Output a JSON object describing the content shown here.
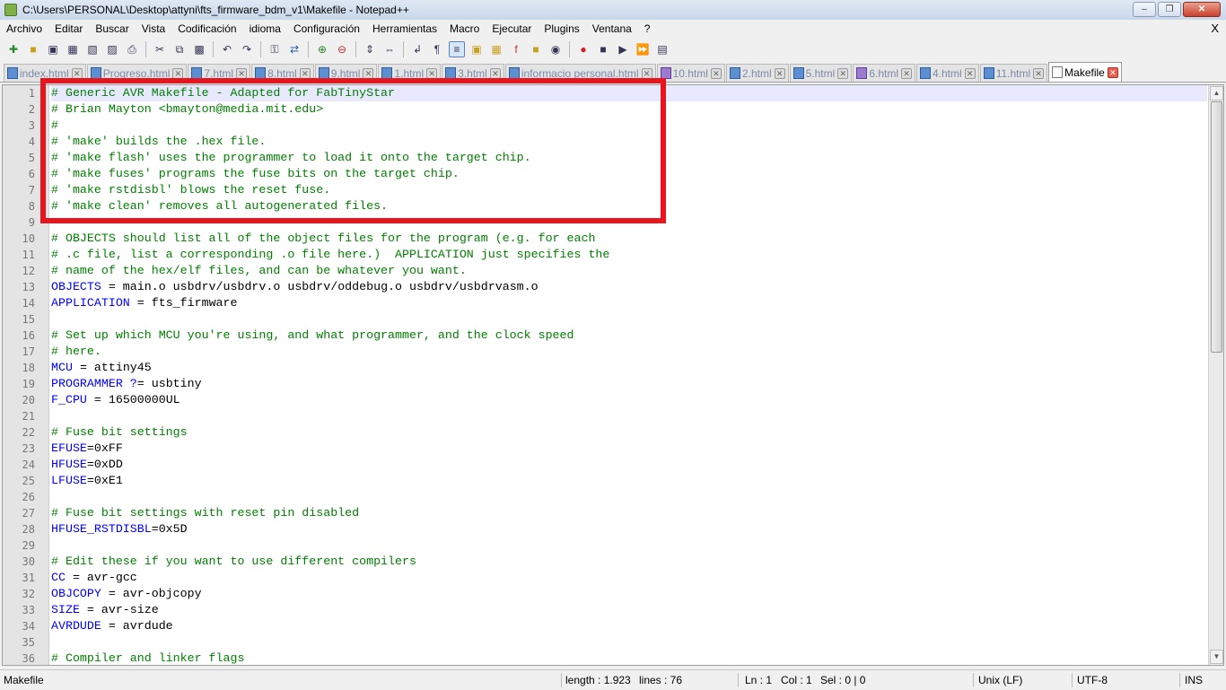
{
  "window": {
    "title": "C:\\Users\\PERSONAL\\Desktop\\attyni\\fts_firmware_bdm_v1\\Makefile - Notepad++",
    "minimize": "–",
    "maximize": "❐",
    "close": "✕"
  },
  "menu": {
    "items": [
      "Archivo",
      "Editar",
      "Buscar",
      "Vista",
      "Codificación",
      "idioma",
      "Configuración",
      "Herramientas",
      "Macro",
      "Ejecutar",
      "Plugins",
      "Ventana",
      "?"
    ],
    "close": "X"
  },
  "toolbar": {
    "icons": [
      "new-file-icon",
      "open-file-icon",
      "save-icon",
      "save-all-icon",
      "close-icon",
      "close-all-icon",
      "print-icon",
      "cut-icon",
      "copy-icon",
      "paste-icon",
      "undo-icon",
      "redo-icon",
      "find-icon",
      "replace-icon",
      "zoom-in-icon",
      "zoom-out-icon",
      "sync-vertical-icon",
      "sync-horizontal-icon",
      "word-wrap-icon",
      "show-all-chars-icon",
      "indent-guide-icon",
      "user-lang-icon",
      "doc-map-icon",
      "function-list-icon",
      "folder-icon",
      "monitor-icon",
      "record-macro-icon",
      "stop-macro-icon",
      "play-macro-icon",
      "run-macro-multiple-icon",
      "save-macro-icon"
    ]
  },
  "tabs": [
    {
      "label": "index.html",
      "icon": "blue"
    },
    {
      "label": "Progreso.html",
      "icon": "blue"
    },
    {
      "label": "7.html",
      "icon": "blue"
    },
    {
      "label": "8.html",
      "icon": "blue"
    },
    {
      "label": "9.html",
      "icon": "blue"
    },
    {
      "label": "1.html",
      "icon": "blue"
    },
    {
      "label": "3.html",
      "icon": "blue"
    },
    {
      "label": "informacio personal.html",
      "icon": "blue"
    },
    {
      "label": "10.html",
      "icon": "purple"
    },
    {
      "label": "2.html",
      "icon": "blue"
    },
    {
      "label": "5.html",
      "icon": "blue"
    },
    {
      "label": "6.html",
      "icon": "purple"
    },
    {
      "label": "4.html",
      "icon": "blue"
    },
    {
      "label": "11.html",
      "icon": "blue"
    },
    {
      "label": "Makefile",
      "icon": "file",
      "active": true
    }
  ],
  "editor": {
    "current_line": 1,
    "lines": [
      "# Generic AVR Makefile - Adapted for FabTinyStar",
      "# Brian Mayton <bmayton@media.mit.edu>",
      "#",
      "# 'make' builds the .hex file.",
      "# 'make flash' uses the programmer to load it onto the target chip.",
      "# 'make fuses' programs the fuse bits on the target chip.",
      "# 'make rstdisbl' blows the reset fuse.",
      "# 'make clean' removes all autogenerated files.",
      "",
      "# OBJECTS should list all of the object files for the program (e.g. for each",
      "# .c file, list a corresponding .o file here.)  APPLICATION just specifies the",
      "# name of the hex/elf files, and can be whatever you want.",
      "OBJECTS = main.o usbdrv/usbdrv.o usbdrv/oddebug.o usbdrv/usbdrvasm.o",
      "APPLICATION = fts_firmware",
      "",
      "# Set up which MCU you're using, and what programmer, and the clock speed",
      "# here.",
      "MCU = attiny45",
      "PROGRAMMER ?= usbtiny",
      "F_CPU = 16500000UL",
      "",
      "# Fuse bit settings",
      "EFUSE=0xFF",
      "HFUSE=0xDD",
      "LFUSE=0xE1",
      "",
      "# Fuse bit settings with reset pin disabled",
      "HFUSE_RSTDISBL=0x5D",
      "",
      "# Edit these if you want to use different compilers",
      "CC = avr-gcc",
      "OBJCOPY = avr-objcopy",
      "SIZE = avr-size",
      "AVRDUDE = avrdude",
      "",
      "# Compiler and linker flags"
    ]
  },
  "status": {
    "file_type": "Makefile",
    "length": "length : 1.923",
    "lines": "lines : 76",
    "ln": "Ln : 1",
    "col": "Col : 1",
    "sel": "Sel : 0 | 0",
    "eol": "Unix (LF)",
    "encoding": "UTF-8",
    "mode": "INS"
  },
  "colors": {
    "comment": "#008000",
    "variable": "#0000ff",
    "highlight_box": "#e8141e"
  }
}
